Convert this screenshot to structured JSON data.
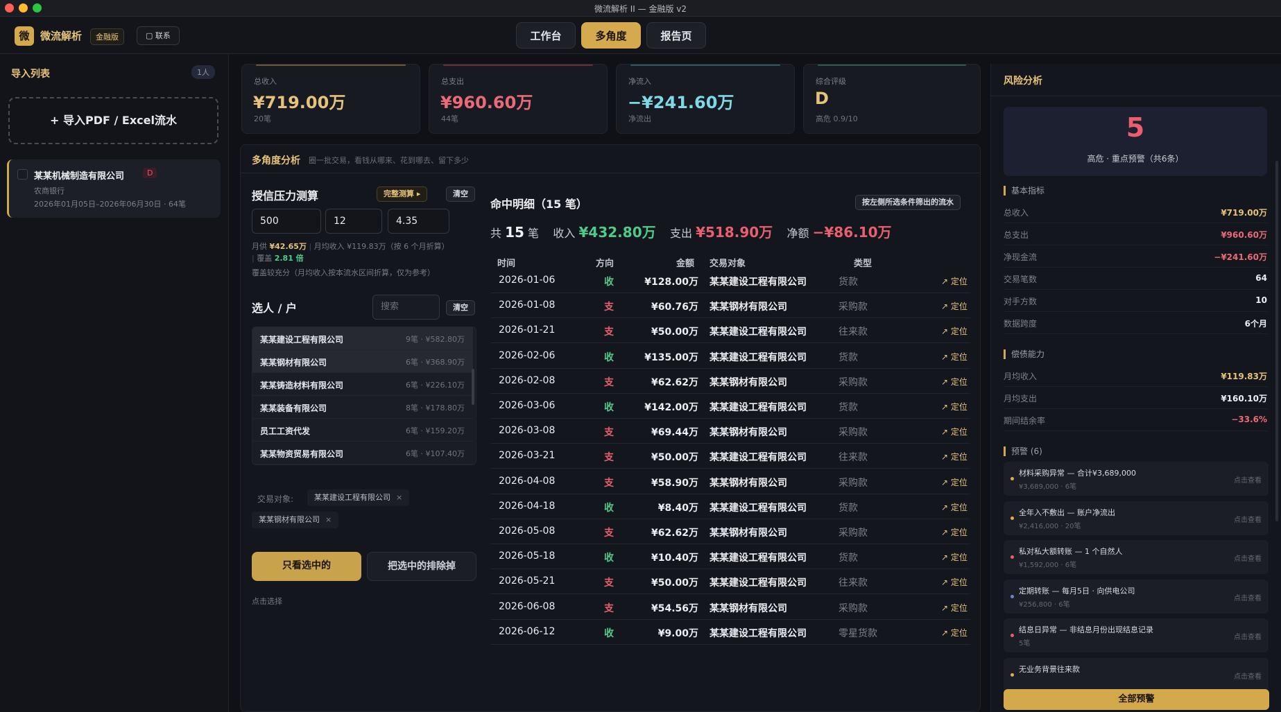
{
  "window": {
    "title": "微流解析 II — 金融版 v2"
  },
  "header": {
    "logo_text": "微",
    "app_name": "微流解析",
    "edition_badge": "金融版",
    "contact_label": "联系",
    "tabs": [
      {
        "label": "工作台",
        "active": false
      },
      {
        "label": "多角度",
        "active": true
      },
      {
        "label": "报告页",
        "active": false
      }
    ]
  },
  "sidebar": {
    "title": "导入列表",
    "count": "1人",
    "import_label": "+ 导入PDF / Excel流水",
    "file": {
      "name": "某某机械制造有限公司",
      "grade": "D",
      "bank": "农商银行",
      "range": "2026年01月05日–2026年06月30日 · 64笔"
    }
  },
  "stats": [
    {
      "label": "总收入",
      "value": "¥719.00万",
      "sub": "20笔",
      "color": "#e6c27a"
    },
    {
      "label": "总支出",
      "value": "¥960.60万",
      "sub": "44笔",
      "color": "#ea6a78"
    },
    {
      "label": "净流入",
      "value": "−¥241.60万",
      "sub": "净流出",
      "color": "#7fd8e6"
    },
    {
      "label": "综合评级",
      "value": "D",
      "sub": "高危 0.9/10",
      "color": "#e6c27a"
    }
  ],
  "analysis": {
    "title": "多角度分析",
    "subtitle": "圈一批交易，看钱从哪来、花到哪去、留下多少",
    "credit": {
      "title": "授信压力测算",
      "full_button": "完整测算 ▸",
      "clear_button": "清空",
      "inputs": [
        "500",
        "12",
        "4.35"
      ],
      "monthly_pay_label": "月供",
      "monthly_pay_value": "¥42.65万",
      "monthly_income_note": "月均收入 ¥119.83万（按 6 个月折算）",
      "coverage_label": "覆盖",
      "coverage_value": "2.81 倍",
      "note": "覆盖较充分（月均收入按本流水区间折算，仅为参考）"
    },
    "party": {
      "title": "选人 / 户",
      "search_placeholder": "搜索",
      "clear_button": "清空",
      "items": [
        {
          "name": "某某建设工程有限公司",
          "meta": "9笔 · ¥582.80万",
          "selected": true
        },
        {
          "name": "某某钢材有限公司",
          "meta": "6笔 · ¥368.90万",
          "selected": true
        },
        {
          "name": "某某铸造材料有限公司",
          "meta": "6笔 · ¥226.10万",
          "selected": false
        },
        {
          "name": "某某装备有限公司",
          "meta": "8笔 · ¥178.80万",
          "selected": false
        },
        {
          "name": "员工工资代发",
          "meta": "6笔 · ¥159.20万",
          "selected": false
        },
        {
          "name": "某某物资贸易有限公司",
          "meta": "6笔 · ¥107.40万",
          "selected": false
        }
      ],
      "filter_label": "交易对象:",
      "tags": [
        "某某建设工程有限公司",
        "某某钢材有限公司"
      ],
      "only_selected_button": "只看选中的",
      "exclude_button": "把选中的排除掉",
      "hint": "点击选择"
    },
    "hits": {
      "title": "命中明细（15 笔）",
      "filter_button": "按左侧所选条件筛出的流水",
      "summary": {
        "count_prefix": "共",
        "count": "15",
        "count_suffix": "笔",
        "income_label": "收入",
        "income": "¥432.80万",
        "expense_label": "支出",
        "expense": "¥518.90万",
        "net_label": "净额",
        "net": "−¥86.10万"
      },
      "columns": [
        "时间",
        "方向",
        "金额",
        "交易对象",
        "类型"
      ],
      "locate_label": "↗ 定位",
      "rows": [
        {
          "date": "2026-01-06",
          "dir": "收",
          "amount": "¥128.00万",
          "party": "某某建设工程有限公司",
          "type": "货款"
        },
        {
          "date": "2026-01-08",
          "dir": "支",
          "amount": "¥60.76万",
          "party": "某某钢材有限公司",
          "type": "采购款"
        },
        {
          "date": "2026-01-21",
          "dir": "支",
          "amount": "¥50.00万",
          "party": "某某建设工程有限公司",
          "type": "往来款"
        },
        {
          "date": "2026-02-06",
          "dir": "收",
          "amount": "¥135.00万",
          "party": "某某建设工程有限公司",
          "type": "货款"
        },
        {
          "date": "2026-02-08",
          "dir": "支",
          "amount": "¥62.62万",
          "party": "某某钢材有限公司",
          "type": "采购款"
        },
        {
          "date": "2026-03-06",
          "dir": "收",
          "amount": "¥142.00万",
          "party": "某某建设工程有限公司",
          "type": "货款"
        },
        {
          "date": "2026-03-08",
          "dir": "支",
          "amount": "¥69.44万",
          "party": "某某钢材有限公司",
          "type": "采购款"
        },
        {
          "date": "2026-03-21",
          "dir": "支",
          "amount": "¥50.00万",
          "party": "某某建设工程有限公司",
          "type": "往来款"
        },
        {
          "date": "2026-04-08",
          "dir": "支",
          "amount": "¥58.90万",
          "party": "某某钢材有限公司",
          "type": "采购款"
        },
        {
          "date": "2026-04-18",
          "dir": "收",
          "amount": "¥8.40万",
          "party": "某某建设工程有限公司",
          "type": "货款"
        },
        {
          "date": "2026-05-08",
          "dir": "支",
          "amount": "¥62.62万",
          "party": "某某钢材有限公司",
          "type": "采购款"
        },
        {
          "date": "2026-05-18",
          "dir": "收",
          "amount": "¥10.40万",
          "party": "某某建设工程有限公司",
          "type": "货款"
        },
        {
          "date": "2026-05-21",
          "dir": "支",
          "amount": "¥50.00万",
          "party": "某某建设工程有限公司",
          "type": "往来款"
        },
        {
          "date": "2026-06-08",
          "dir": "支",
          "amount": "¥54.56万",
          "party": "某某钢材有限公司",
          "type": "采购款"
        },
        {
          "date": "2026-06-12",
          "dir": "收",
          "amount": "¥9.00万",
          "party": "某某建设工程有限公司",
          "type": "零星货款"
        }
      ]
    }
  },
  "risk": {
    "title": "风险分析",
    "score": "5",
    "score_label": "高危 · 重点预警（共6条）",
    "basic_title": "基本指标",
    "basic": [
      {
        "k": "总收入",
        "v": "¥719.00万",
        "color": "#e6c27a"
      },
      {
        "k": "总支出",
        "v": "¥960.60万",
        "color": "#ea6a78"
      },
      {
        "k": "净现金流",
        "v": "−¥241.60万",
        "color": "#ea6a78"
      },
      {
        "k": "交易笔数",
        "v": "64",
        "color": "#eceef2"
      },
      {
        "k": "对手方数",
        "v": "10",
        "color": "#eceef2"
      },
      {
        "k": "数据跨度",
        "v": "6个月",
        "color": "#eceef2"
      }
    ],
    "repay_title": "偿债能力",
    "repay": [
      {
        "k": "月均收入",
        "v": "¥119.83万",
        "color": "#e6c27a"
      },
      {
        "k": "月均支出",
        "v": "¥160.10万",
        "color": "#eceef2"
      },
      {
        "k": "期间结余率",
        "v": "−33.6%",
        "color": "#ea6a78"
      }
    ],
    "alerts_title": "预警 (6)",
    "alerts": [
      {
        "title": "材料采购异常 — 合计¥3,689,000",
        "sub": "¥3,689,000 · 6笔",
        "dot": "#e6a94c"
      },
      {
        "title": "全年入不敷出 — 账户净流出",
        "sub": "¥2,416,000 · 20笔",
        "dot": "#e6a94c"
      },
      {
        "title": "私对私大额转账 — 1 个自然人",
        "sub": "¥1,592,000 · 6笔",
        "dot": "#ea5e6e"
      },
      {
        "title": "定期转账 — 每月5日 · 向供电公司",
        "sub": "¥256,800 · 6笔",
        "dot": "#6f7fe0"
      },
      {
        "title": "结息日异常 — 非结息月份出现结息记录",
        "sub": "5笔",
        "dot": "#ea5e6e"
      },
      {
        "title": "无业务背景往来款",
        "sub": "",
        "dot": "#e6a94c"
      }
    ],
    "alert_action": "点击查看",
    "all_button": "全部预警"
  }
}
